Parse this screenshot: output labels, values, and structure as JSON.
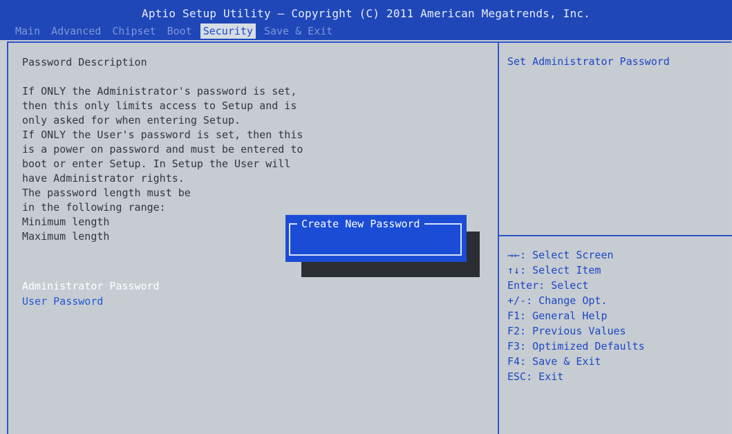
{
  "window": {
    "title": "Aptio Setup Utility – Copyright (C) 2011 American Megatrends, Inc."
  },
  "tabs": [
    {
      "label": "Main"
    },
    {
      "label": "Advanced"
    },
    {
      "label": "Chipset"
    },
    {
      "label": "Boot"
    },
    {
      "label": "Security"
    },
    {
      "label": "Save & Exit"
    }
  ],
  "active_tab": "Security",
  "description": {
    "heading": "Password Description",
    "lines": [
      "If ONLY the Administrator's password is set,",
      "then this only limits access to Setup and is",
      "only asked for when entering Setup.",
      "If ONLY the User's password is set, then this",
      "is a power on password and must be entered to",
      "boot or enter Setup. In Setup the User will",
      "have Administrator rights.",
      "The password length must be",
      "in the following range:",
      "Minimum length",
      "Maximum length"
    ]
  },
  "menu": {
    "items": [
      {
        "label": "Administrator Password",
        "selected": true
      },
      {
        "label": "User Password",
        "selected": false
      }
    ]
  },
  "help": {
    "text": "Set Administrator Password"
  },
  "keys": [
    "→←: Select Screen",
    "↑↓: Select Item",
    "Enter: Select",
    "+/-: Change Opt.",
    "F1: General Help",
    "F2: Previous Values",
    "F3: Optimized Defaults",
    "F4: Save & Exit",
    "ESC: Exit"
  ],
  "dialog": {
    "title": "Create New Password",
    "value": ""
  },
  "colors": {
    "header_bg": "#1f47b8",
    "panel_bg": "#c7ccd2",
    "accent": "#1b48c4",
    "dialog_bg": "#1a4cd6"
  }
}
